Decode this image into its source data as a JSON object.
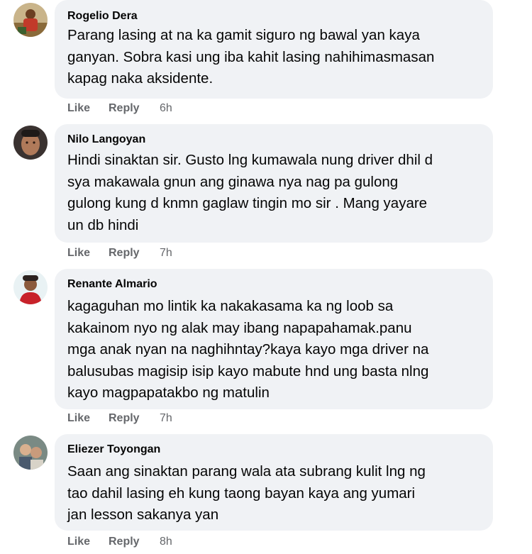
{
  "comments": [
    {
      "author": "Rogelio Dera",
      "lines": [
        "Parang lasing at na ka gamit siguro ng bawal yan kaya",
        "ganyan. Sobra kasi ung iba kahit lasing nahihimasmasan",
        "kapag naka aksidente."
      ],
      "like": "Like",
      "reply": "Reply",
      "time": "6h"
    },
    {
      "author": "Nilo Langoyan",
      "lines": [
        "Hindi sinaktan sir. Gusto lng kumawala nung driver dhil d",
        "sya makawala gnun ang ginawa nya nag pa gulong",
        "gulong kung d knmn gaglaw tingin mo sir . Mang yayare",
        "un db hindi"
      ],
      "like": "Like",
      "reply": "Reply",
      "time": "7h"
    },
    {
      "author": "Renante Almario",
      "lines": [
        "kagaguhan mo lintik ka nakakasama ka ng loob sa",
        "kakainom nyo ng alak may ibang napapahamak.panu",
        "mga anak nyan na naghihntay?kaya kayo mga driver na",
        "balusubas magisip isip kayo mabute hnd ung basta nlng",
        "kayo magpapatakbo ng matulin"
      ],
      "like": "Like",
      "reply": "Reply",
      "time": "7h"
    },
    {
      "author": "Eliezer Toyongan",
      "lines": [
        "Saan ang sinaktan parang wala ata subrang kulit lng ng",
        "tao dahil lasing eh kung taong bayan kaya ang yumari",
        "jan lesson sakanya yan"
      ],
      "like": "Like",
      "reply": "Reply",
      "time": "8h"
    }
  ]
}
